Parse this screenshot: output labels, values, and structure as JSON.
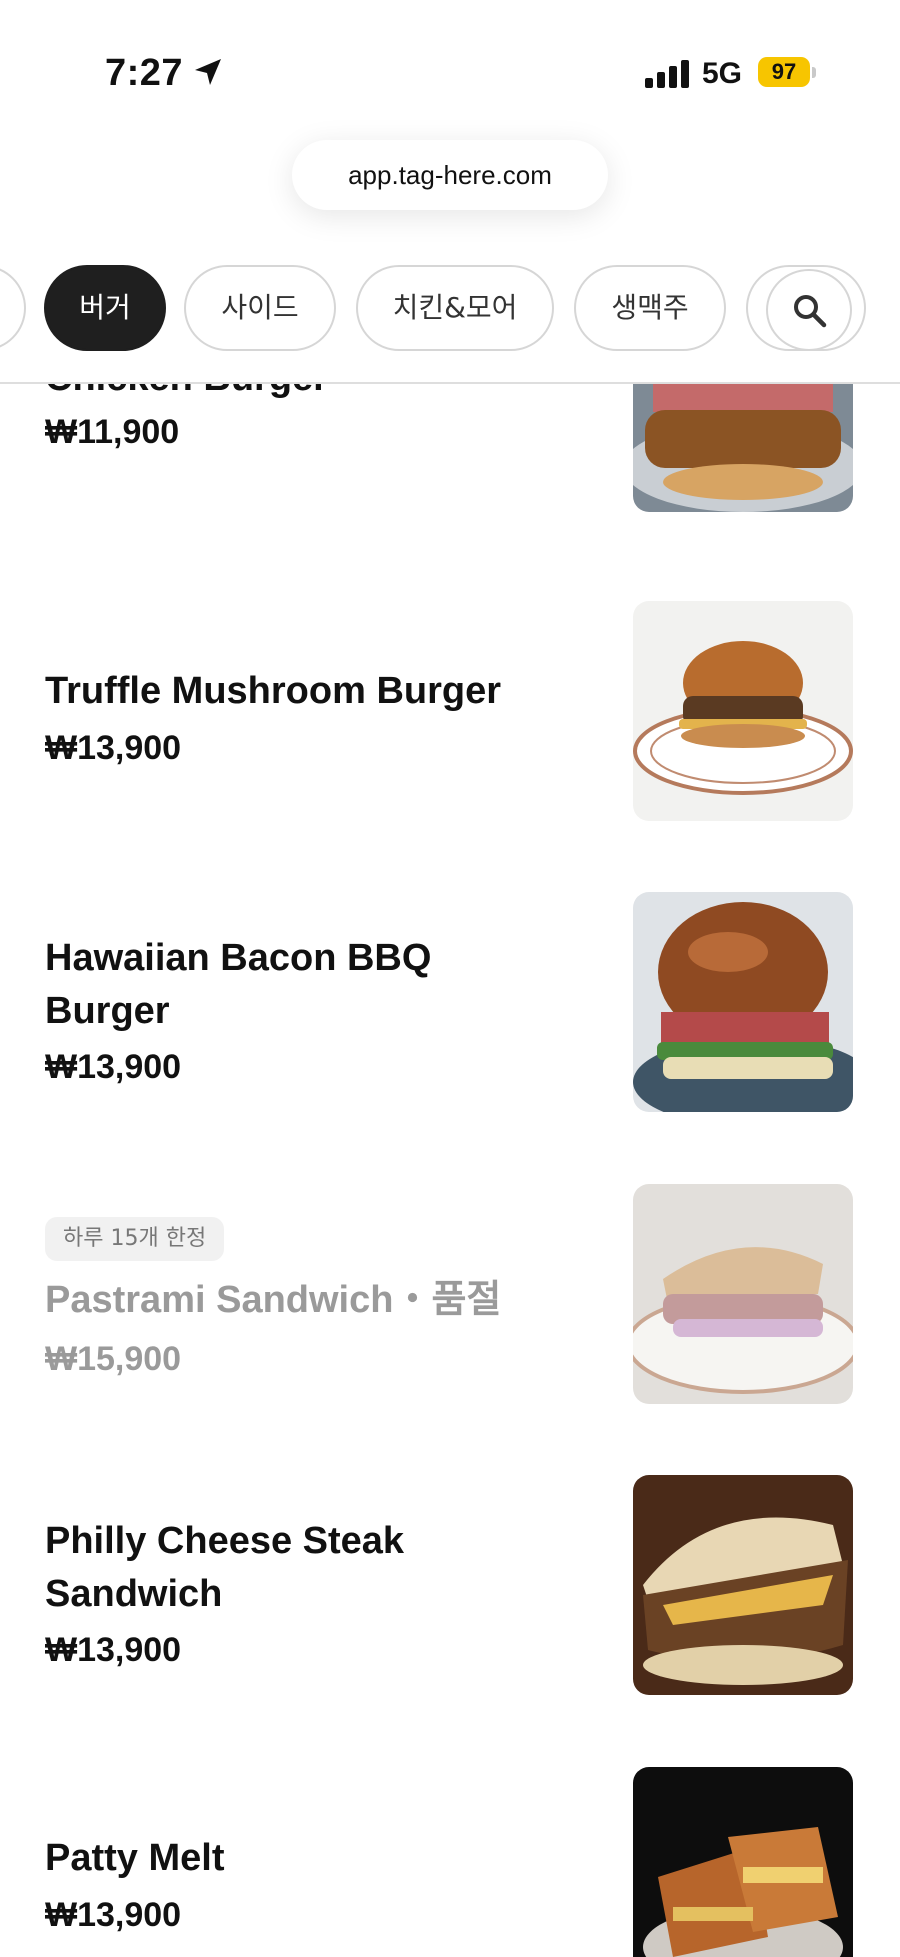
{
  "status_bar": {
    "time": "7:27",
    "network": "5G",
    "battery": "97",
    "icons": [
      "location-arrow-icon",
      "signal-icon",
      "battery-icon"
    ]
  },
  "browser": {
    "url": "app.tag-here.com"
  },
  "categories": {
    "items": [
      {
        "label": "버거",
        "active": true
      },
      {
        "label": "사이드",
        "active": false
      },
      {
        "label": "치킨&모어",
        "active": false
      },
      {
        "label": "생맥주",
        "active": false
      }
    ],
    "search_icon": "search-icon"
  },
  "menu": {
    "items": [
      {
        "name": "Chicken Burger",
        "price": "₩11,900",
        "image": "chicken-burger-photo"
      },
      {
        "name": "Truffle Mushroom Burger",
        "price": "₩13,900",
        "image": "truffle-mushroom-burger-photo"
      },
      {
        "name": "Hawaiian Bacon BBQ Burger",
        "price": "₩13,900",
        "image": "hawaiian-bacon-bbq-burger-photo"
      },
      {
        "name": "Pastrami Sandwich・품절",
        "price": "₩15,900",
        "badge": "하루 15개 한정",
        "sold_out": true,
        "image": "pastrami-sandwich-photo"
      },
      {
        "name": "Philly Cheese Steak Sandwich",
        "price": "₩13,900",
        "image": "philly-cheese-steak-photo"
      },
      {
        "name": "Patty Melt",
        "price": "₩13,900",
        "image": "patty-melt-photo"
      }
    ]
  },
  "colors": {
    "active_chip": "#1f1f1f",
    "battery": "#f7c500",
    "sold_out_text": "#9a9a9a"
  }
}
